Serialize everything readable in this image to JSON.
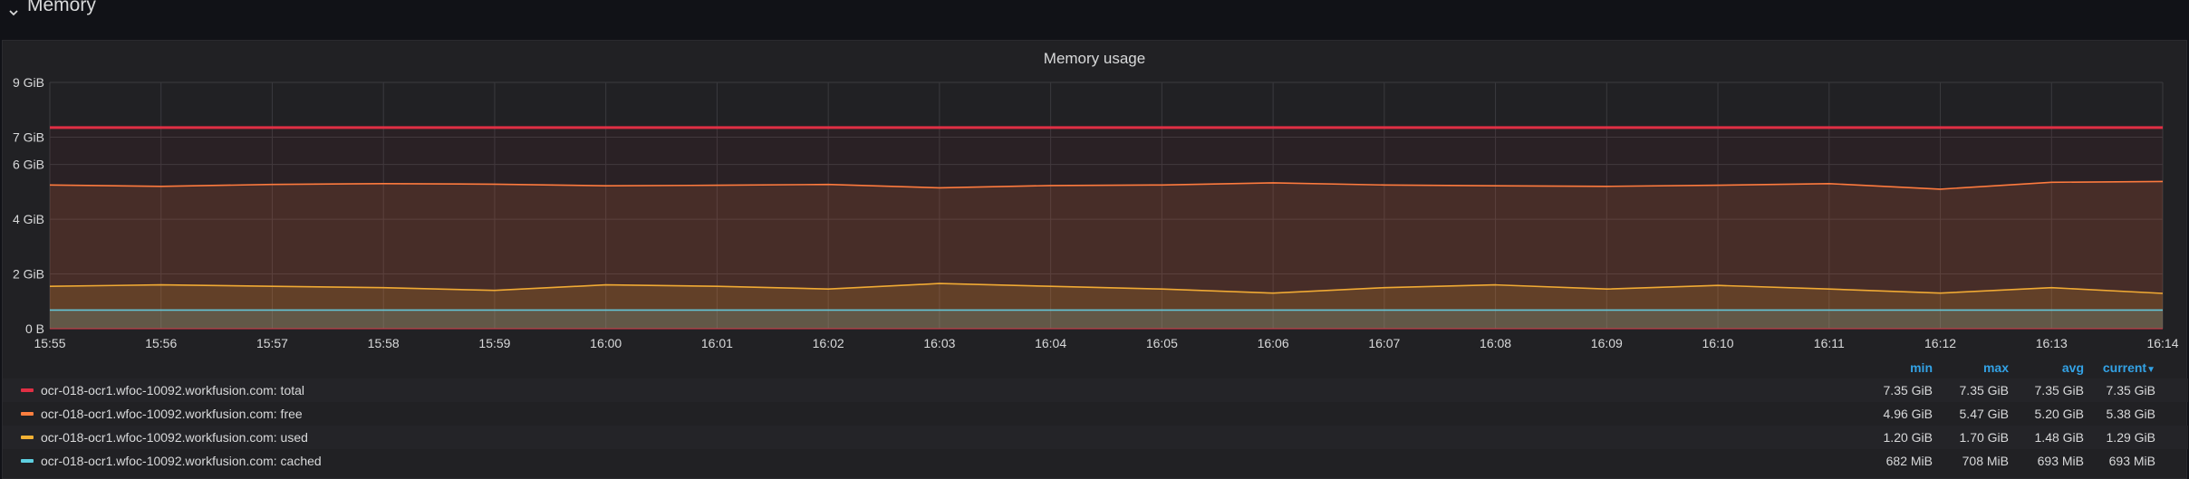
{
  "row": {
    "title": "Memory",
    "chevron_icon": "chevron-down-icon"
  },
  "panel": {
    "title": "Memory usage"
  },
  "legend": {
    "columns": {
      "min": "min",
      "max": "max",
      "avg": "avg",
      "current": "current",
      "current_sort_icon": "caret-down-icon"
    },
    "series": [
      {
        "name": "ocr-018-ocr1.wfoc-10092.workfusion.com: total",
        "color": "#e02f44",
        "min": "7.35 GiB",
        "max": "7.35 GiB",
        "avg": "7.35 GiB",
        "current": "7.35 GiB"
      },
      {
        "name": "ocr-018-ocr1.wfoc-10092.workfusion.com: free",
        "color": "#ff7f3f",
        "min": "4.96 GiB",
        "max": "5.47 GiB",
        "avg": "5.20 GiB",
        "current": "5.38 GiB"
      },
      {
        "name": "ocr-018-ocr1.wfoc-10092.workfusion.com: used",
        "color": "#f2b134",
        "min": "1.20 GiB",
        "max": "1.70 GiB",
        "avg": "1.48 GiB",
        "current": "1.29 GiB"
      },
      {
        "name": "ocr-018-ocr1.wfoc-10092.workfusion.com: cached",
        "color": "#5ecfe0",
        "min": "682 MiB",
        "max": "708 MiB",
        "avg": "693 MiB",
        "current": "693 MiB"
      }
    ]
  },
  "chart_data": {
    "type": "area",
    "title": "Memory usage",
    "xlabel": "",
    "ylabel": "",
    "x_ticks": [
      "15:55",
      "15:56",
      "15:57",
      "15:58",
      "15:59",
      "16:00",
      "16:01",
      "16:02",
      "16:03",
      "16:04",
      "16:05",
      "16:06",
      "16:07",
      "16:08",
      "16:09",
      "16:10",
      "16:11",
      "16:12",
      "16:13",
      "16:14"
    ],
    "y_ticks": [
      "0 B",
      "2 GiB",
      "4 GiB",
      "6 GiB",
      "7 GiB",
      "9 GiB"
    ],
    "y_tick_values": [
      0,
      2,
      4,
      6,
      7,
      9
    ],
    "ylim": [
      0,
      9
    ],
    "y_unit": "GiB",
    "x_time_range": [
      "15:55",
      "16:14"
    ],
    "grid": true,
    "legend_position": "bottom",
    "series": [
      {
        "name": "ocr-018-ocr1.wfoc-10092.workfusion.com: total",
        "color": "#e02f44",
        "values": [
          7.35,
          7.35,
          7.35,
          7.35,
          7.35,
          7.35,
          7.35,
          7.35,
          7.35,
          7.35,
          7.35,
          7.35,
          7.35,
          7.35,
          7.35,
          7.35,
          7.35,
          7.35,
          7.35,
          7.35
        ]
      },
      {
        "name": "ocr-018-ocr1.wfoc-10092.workfusion.com: free",
        "color": "#ff7f3f",
        "values": [
          5.25,
          5.2,
          5.27,
          5.3,
          5.28,
          5.22,
          5.24,
          5.27,
          5.15,
          5.23,
          5.25,
          5.33,
          5.25,
          5.22,
          5.2,
          5.24,
          5.3,
          5.1,
          5.35,
          5.38
        ]
      },
      {
        "name": "ocr-018-ocr1.wfoc-10092.workfusion.com: used",
        "color": "#f2b134",
        "values": [
          1.55,
          1.6,
          1.55,
          1.5,
          1.4,
          1.6,
          1.55,
          1.45,
          1.65,
          1.55,
          1.45,
          1.3,
          1.5,
          1.6,
          1.45,
          1.58,
          1.45,
          1.3,
          1.5,
          1.29
        ]
      },
      {
        "name": "ocr-018-ocr1.wfoc-10092.workfusion.com: cached",
        "color": "#5ecfe0",
        "values": [
          0.68,
          0.68,
          0.68,
          0.68,
          0.68,
          0.68,
          0.68,
          0.68,
          0.68,
          0.68,
          0.68,
          0.68,
          0.68,
          0.68,
          0.68,
          0.68,
          0.68,
          0.68,
          0.68,
          0.68
        ]
      }
    ]
  }
}
